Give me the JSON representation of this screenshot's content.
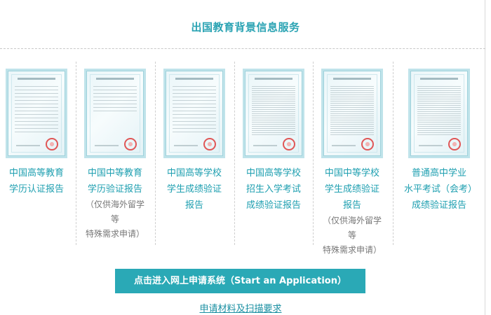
{
  "header": {
    "title": "出国教育背景信息服务"
  },
  "cards": [
    {
      "lines": [
        "中国高等教育",
        "学历认证报告"
      ],
      "note": [],
      "cert_title": "中国高等教育学历认证报告"
    },
    {
      "lines": [
        "中国中等教育",
        "学历验证报告"
      ],
      "note": [
        "（仅供海外留学等",
        "特殊需求申请）"
      ],
      "cert_title": "中国中等教育学历验证报告"
    },
    {
      "lines": [
        "中国高等学校",
        "学生成绩验证",
        "报告"
      ],
      "note": [],
      "cert_title": "中国高等学校学生成绩验证报告"
    },
    {
      "lines": [
        "中国高等学校",
        "招生入学考试",
        "成绩验证报告"
      ],
      "note": [],
      "cert_title": "中国高等学校招生入学考试成绩验证报告"
    },
    {
      "lines": [
        "中国中等学校",
        "学生成绩验证",
        "报告"
      ],
      "note": [
        "（仅供海外留学等",
        "特殊需求申请）"
      ],
      "cert_title": "中国中等学校学生成绩验证报告"
    },
    {
      "lines": [
        "普通高中学业",
        "水平考试（会考）",
        "成绩验证报告"
      ],
      "note": [],
      "cert_title": "普通高中学业水平考试（会考）成绩验证报告"
    }
  ],
  "actions": {
    "apply_label": "点击进入网上申请系统（Start an Application）",
    "materials_link": "申请材料及扫描要求"
  },
  "colors": {
    "accent": "#2aa9b6",
    "link": "#1a8fa2",
    "seal": "#e05656"
  }
}
